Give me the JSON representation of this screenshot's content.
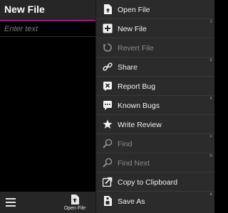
{
  "titlebar": {
    "title": "New File"
  },
  "editor": {
    "placeholder": "Enter text"
  },
  "menu": {
    "items": [
      {
        "label": "Open File",
        "key": "",
        "icon": "open-file-icon",
        "disabled": false
      },
      {
        "label": "New File",
        "key": "Z",
        "icon": "new-file-icon",
        "disabled": false
      },
      {
        "label": "Revert File",
        "key": "",
        "icon": "revert-icon",
        "disabled": true
      },
      {
        "label": "Share",
        "key": "E",
        "icon": "share-icon",
        "disabled": false
      },
      {
        "label": "Report Bug",
        "key": "",
        "icon": "report-bug-icon",
        "disabled": false
      },
      {
        "label": "Known Bugs",
        "key": "K",
        "icon": "known-bugs-icon",
        "disabled": false
      },
      {
        "label": "Write Review",
        "key": "",
        "icon": "star-icon",
        "disabled": false
      },
      {
        "label": "Find",
        "key": "F",
        "icon": "search-icon",
        "disabled": true
      },
      {
        "label": "Find Next",
        "key": "N",
        "icon": "search-icon",
        "disabled": true
      },
      {
        "label": "Copy to Clipboard",
        "key": "",
        "icon": "copy-icon",
        "disabled": false
      },
      {
        "label": "Save As",
        "key": "A",
        "icon": "save-as-icon",
        "disabled": false
      }
    ]
  },
  "bottombar": {
    "open_label": "Open File"
  },
  "colors": {
    "accent": "#b0108a",
    "menu_bg": "#2b2b2b",
    "bar_bg": "#262626"
  }
}
